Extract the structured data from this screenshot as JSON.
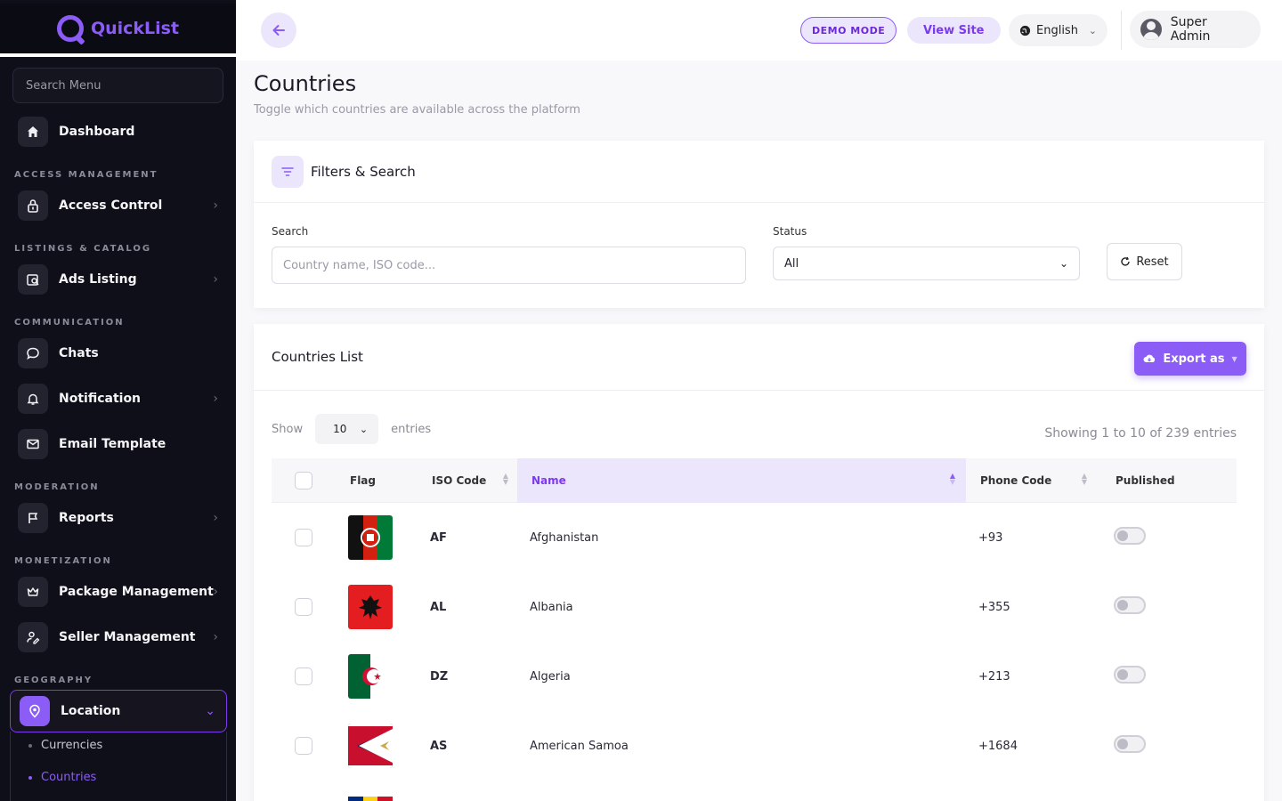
{
  "app": {
    "name": "QuickList"
  },
  "sidebar": {
    "search_placeholder": "Search Menu",
    "sections": {
      "access": "ACCESS MANAGEMENT",
      "listings": "LISTINGS & CATALOG",
      "communication": "COMMUNICATION",
      "moderation": "MODERATION",
      "monetization": "MONETIZATION",
      "geography": "GEOGRAPHY"
    },
    "items": {
      "dashboard": "Dashboard",
      "access_control": "Access Control",
      "ads_listing": "Ads Listing",
      "chats": "Chats",
      "notification": "Notification",
      "email_template": "Email Template",
      "reports": "Reports",
      "package_management": "Package Management",
      "seller_management": "Seller Management",
      "location": "Location"
    },
    "submenu": {
      "currencies": "Currencies",
      "countries": "Countries"
    }
  },
  "header": {
    "demo_badge": "DEMO MODE",
    "view_site": "View Site",
    "language": "English",
    "user_name": "Super Admin"
  },
  "page": {
    "title": "Countries",
    "subtitle": "Toggle which countries are available across the platform"
  },
  "filters": {
    "title": "Filters & Search",
    "search_label": "Search",
    "search_placeholder": "Country name, ISO code...",
    "status_label": "Status",
    "status_value": "All",
    "reset_label": "Reset"
  },
  "list": {
    "title": "Countries List",
    "export_label": "Export as",
    "show_label": "Show",
    "entries_value": "10",
    "entries_label": "entries",
    "showing_text": "Showing 1 to 10 of 239 entries",
    "columns": {
      "flag": "Flag",
      "iso": "ISO Code",
      "name": "Name",
      "phone": "Phone Code",
      "published": "Published"
    },
    "rows": [
      {
        "iso": "AF",
        "name": "Afghanistan",
        "phone": "+93",
        "published": false
      },
      {
        "iso": "AL",
        "name": "Albania",
        "phone": "+355",
        "published": false
      },
      {
        "iso": "DZ",
        "name": "Algeria",
        "phone": "+213",
        "published": false
      },
      {
        "iso": "AS",
        "name": "American Samoa",
        "phone": "+1684",
        "published": false
      }
    ]
  },
  "colors": {
    "accent": "#8b5cf6",
    "sidebar_bg": "#0f0f1a",
    "accent_light": "#ece6fc"
  },
  "icons": {
    "dashboard": "home-icon",
    "access_control": "lock-icon",
    "ads_listing": "listing-icon",
    "chats": "chat-icon",
    "notification": "bell-icon",
    "email_template": "mail-icon",
    "reports": "flag-icon",
    "package_management": "crown-icon",
    "seller_management": "user-edit-icon",
    "location": "map-pin-icon"
  }
}
